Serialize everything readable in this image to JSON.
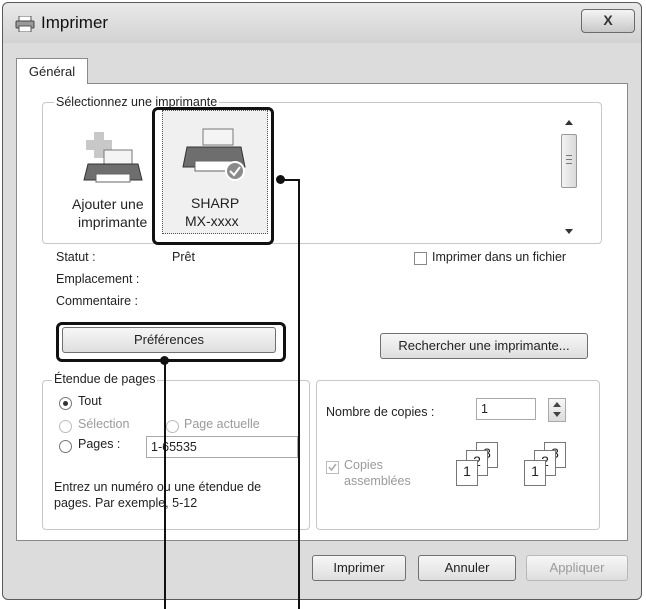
{
  "window": {
    "title": "Imprimer",
    "close_label": "X"
  },
  "tabs": [
    {
      "label": "Général"
    }
  ],
  "printer_group": {
    "label": "Sélectionnez une imprimante",
    "items": [
      {
        "line1": "Ajouter une",
        "line2": "imprimante",
        "icon": "add-printer-icon"
      },
      {
        "line1": "SHARP",
        "line2": "MX-xxxx",
        "icon": "printer-icon"
      }
    ]
  },
  "status": {
    "status_label": "Statut :",
    "status_value": "Prêt",
    "location_label": "Emplacement :",
    "comment_label": "Commentaire :"
  },
  "print_to_file_label": "Imprimer dans un fichier",
  "buttons": {
    "preferences": "Préférences",
    "find_printer": "Rechercher une imprimante...",
    "print": "Imprimer",
    "cancel": "Annuler",
    "apply": "Appliquer"
  },
  "page_range": {
    "label": "Étendue de pages",
    "all": "Tout",
    "selection": "Sélection",
    "current_page": "Page actuelle",
    "pages": "Pages :",
    "pages_value": "1-65535",
    "hint": "Entrez un numéro ou une étendue de pages. Par exemple, 5-12",
    "hint_line1": "Entrez un numéro ou une étendue de",
    "hint_line2": "pages. Par exemple, 5-12"
  },
  "copies": {
    "label": "Nombre de copies :",
    "value": "1",
    "collate_line1": "Copies",
    "collate_line2": "assemblées",
    "collate_icon_digits": [
      "1",
      "2",
      "3"
    ]
  },
  "colors": {
    "callout": "#111111",
    "window_bg": "#dcdcdc",
    "panel_bg": "#ffffff"
  }
}
